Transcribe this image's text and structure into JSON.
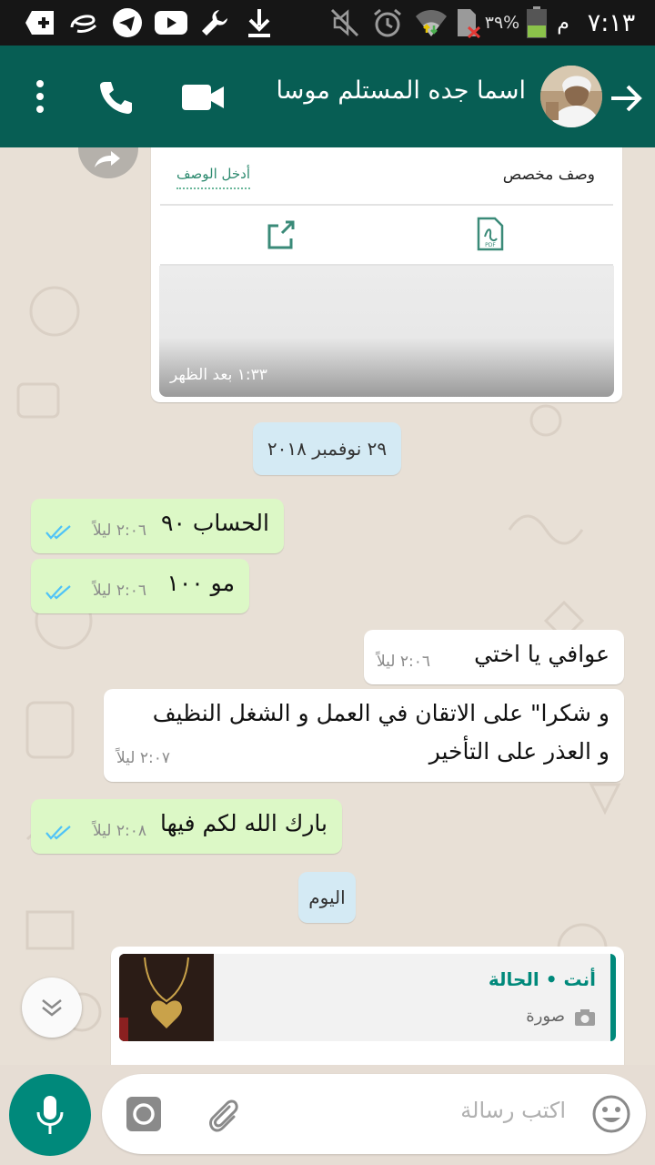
{
  "status_bar": {
    "time": "٧:١٣",
    "am_pm": "م",
    "battery": "٣٩%"
  },
  "header": {
    "contact_name": "اسما جده المستلم موسا"
  },
  "doc_card": {
    "description_label": "وصف مخصص",
    "description_link": "أدخل الوصف",
    "time": "١:٣٣ بعد الظهر"
  },
  "date_separators": {
    "first": "٢٩ نوفمبر ٢٠١٨",
    "today": "اليوم"
  },
  "messages": [
    {
      "text": "الحساب ٩٠",
      "time": "٢:٠٦ ليلاً"
    },
    {
      "text": "مو ١٠٠",
      "time": "٢:٠٦ ليلاً"
    },
    {
      "text": "عوافي يا اختي",
      "time": "٢:٠٦ ليلاً"
    },
    {
      "line1": "و شكرا\" على الاتقان في العمل و الشغل النظيف",
      "line2": "و العذر على التأخير",
      "time": "٢:٠٧ ليلاً"
    },
    {
      "text": "بارك الله لكم فيها",
      "time": "٢:٠٨ ليلاً"
    }
  ],
  "reply_preview": {
    "author": "أنت • الحالة",
    "type": "صورة"
  },
  "input": {
    "placeholder": "اكتب رسالة"
  },
  "colors": {
    "header": "#075e54",
    "outgoing_bubble": "#dcf8c6",
    "incoming_bubble": "#ffffff",
    "accent": "#00897b",
    "read_ticks": "#4fc3f7"
  }
}
